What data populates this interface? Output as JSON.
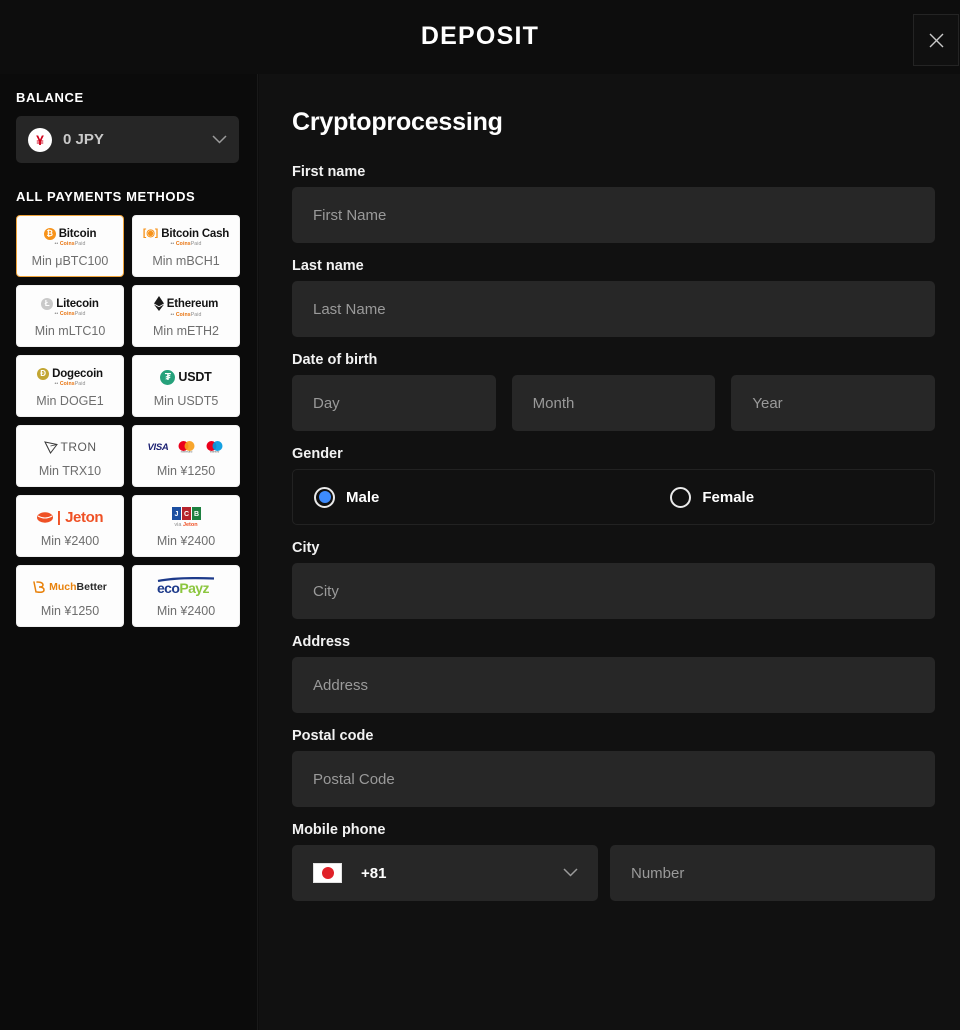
{
  "header": {
    "title": "DEPOSIT",
    "close_icon": "close-icon"
  },
  "sidebar": {
    "balance_heading": "BALANCE",
    "balance": {
      "currency_icon": "yen-icon",
      "value": "0 JPY",
      "chevron_icon": "chevron-down-icon"
    },
    "methods_heading": "ALL PAYMENTS METHODS",
    "methods": [
      {
        "name": "Bitcoin",
        "logo": "bitcoin-icon",
        "symbol": "Ƀ",
        "color": "#f7931a",
        "provider": "CoinsPaid",
        "min": "Min μBTC100",
        "selected": true
      },
      {
        "name": "Bitcoin Cash",
        "logo": "bitcoin-cash-icon",
        "symbol": "Ƀ",
        "color": "#f7931a",
        "provider": "CoinsPaid",
        "min": "Min mBCH1",
        "selected": false
      },
      {
        "name": "Litecoin",
        "logo": "litecoin-icon",
        "symbol": "Ł",
        "color": "#bfbbbb",
        "provider": "CoinsPaid",
        "min": "Min mLTC10",
        "selected": false
      },
      {
        "name": "Ethereum",
        "logo": "ethereum-icon",
        "symbol": "⧫",
        "color": "#111111",
        "provider": "CoinsPaid",
        "min": "Min mETH2",
        "selected": false
      },
      {
        "name": "Dogecoin",
        "logo": "dogecoin-icon",
        "symbol": "D",
        "color": "#c2a633",
        "provider": "CoinsPaid",
        "min": "Min DOGE1",
        "selected": false
      },
      {
        "name": "USDT",
        "logo": "tether-icon",
        "symbol": "₮",
        "color": "#26a17b",
        "provider": "",
        "min": "Min USDT5",
        "selected": false
      },
      {
        "name": "TRON",
        "logo": "tron-icon",
        "symbol": "",
        "color": "#333333",
        "provider": "",
        "min": "Min TRX10",
        "selected": false
      },
      {
        "name": "VISA / Mastercard / Maestro",
        "logo": "card-brands-icon",
        "symbol": "",
        "color": "#1a1f71",
        "provider": "",
        "min": "Min ¥1250",
        "selected": false
      },
      {
        "name": "Jeton",
        "logo": "jeton-icon",
        "symbol": "",
        "color": "#ef5125",
        "provider": "",
        "min": "Min ¥2400",
        "selected": false
      },
      {
        "name": "JCB",
        "logo": "jcb-icon",
        "symbol": "",
        "color": "#1b4ea0",
        "provider": "via Jeton",
        "min": "Min ¥2400",
        "selected": false
      },
      {
        "name": "MuchBetter",
        "logo": "muchbetter-icon",
        "symbol": "",
        "color": "#e8820c",
        "provider": "",
        "min": "Min ¥1250",
        "selected": false
      },
      {
        "name": "ecoPayz",
        "logo": "ecopayz-icon",
        "symbol": "",
        "color": "#1d3a8a",
        "provider": "",
        "min": "Min ¥2400",
        "selected": false
      }
    ]
  },
  "form": {
    "title": "Cryptoprocessing",
    "first_name": {
      "label": "First name",
      "placeholder": "First Name",
      "value": ""
    },
    "last_name": {
      "label": "Last name",
      "placeholder": "Last Name",
      "value": ""
    },
    "dob": {
      "label": "Date of birth",
      "day": {
        "placeholder": "Day",
        "value": ""
      },
      "month": {
        "placeholder": "Month",
        "value": ""
      },
      "year": {
        "placeholder": "Year",
        "value": ""
      }
    },
    "gender": {
      "label": "Gender",
      "options": [
        {
          "label": "Male",
          "selected": true
        },
        {
          "label": "Female",
          "selected": false
        }
      ]
    },
    "city": {
      "label": "City",
      "placeholder": "City",
      "value": ""
    },
    "address": {
      "label": "Address",
      "placeholder": "Address",
      "value": ""
    },
    "postal_code": {
      "label": "Postal code",
      "placeholder": "Postal Code",
      "value": ""
    },
    "mobile_phone": {
      "label": "Mobile phone",
      "country_flag": "japan-flag-icon",
      "country_code": "+81",
      "chevron_icon": "chevron-down-icon",
      "number_placeholder": "Number",
      "number_value": ""
    }
  },
  "colors": {
    "accent": "#f0a43a",
    "radio_selected": "#3d8bfd",
    "background": "#111111",
    "input_background": "#272727"
  }
}
